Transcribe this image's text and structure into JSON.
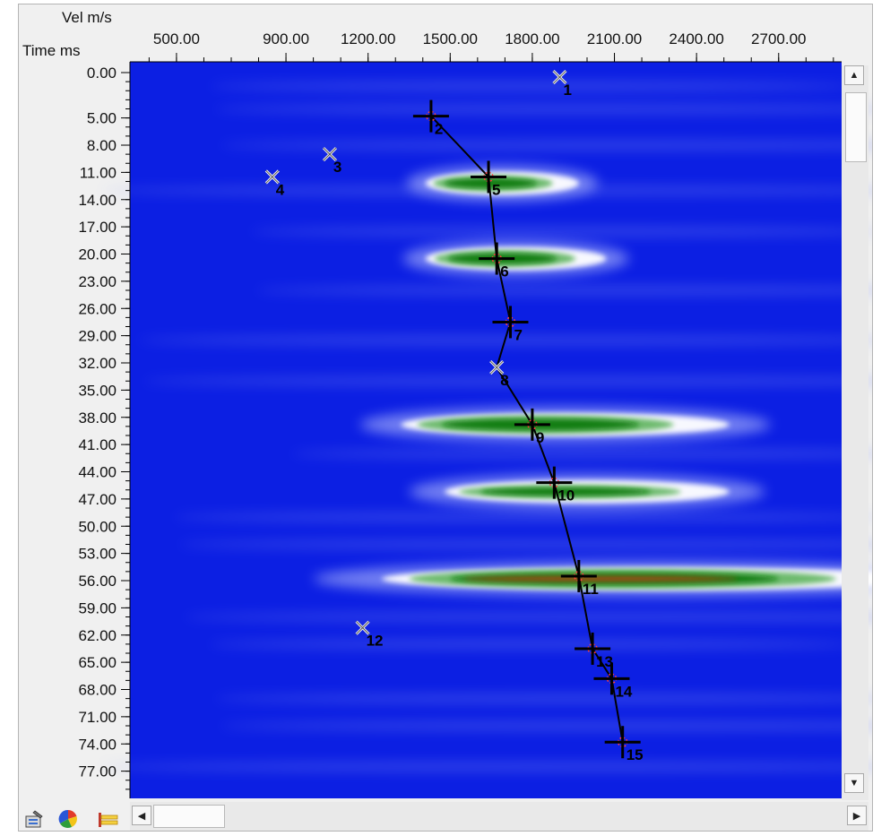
{
  "app": {
    "vel_label": "Vel m/s",
    "time_label": "Time ms"
  },
  "chart_data": {
    "type": "scatter",
    "title": "",
    "xlabel": "Vel m/s",
    "ylabel": "Time ms",
    "x_ticks": [
      "500.00",
      "900.00",
      "1200.00",
      "1500.00",
      "1800.00",
      "2100.00",
      "2400.00",
      "2700.00"
    ],
    "x_tick_values": [
      500,
      900,
      1200,
      1500,
      1800,
      2100,
      2400,
      2700
    ],
    "y_ticks": [
      "0.00",
      "5.00",
      "8.00",
      "11.00",
      "14.00",
      "17.00",
      "20.00",
      "23.00",
      "26.00",
      "29.00",
      "32.00",
      "35.00",
      "38.00",
      "41.00",
      "44.00",
      "47.00",
      "50.00",
      "53.00",
      "56.00",
      "59.00",
      "62.00",
      "65.00",
      "68.00",
      "71.00",
      "74.00",
      "77.00"
    ],
    "y_tick_values": [
      0,
      5,
      8,
      11,
      14,
      17,
      20,
      23,
      26,
      29,
      32,
      35,
      38,
      41,
      44,
      47,
      50,
      53,
      56,
      59,
      62,
      65,
      68,
      71,
      74,
      77
    ],
    "xlim": [
      330,
      2930
    ],
    "ylim": [
      0,
      80
    ],
    "picks": [
      {
        "label": "1",
        "velocity": 1900,
        "time": 0.5,
        "style": "x"
      },
      {
        "label": "2",
        "velocity": 1430,
        "time": 4.8,
        "style": "cross"
      },
      {
        "label": "3",
        "velocity": 1060,
        "time": 9.0,
        "style": "x"
      },
      {
        "label": "4",
        "velocity": 850,
        "time": 11.5,
        "style": "x"
      },
      {
        "label": "5",
        "velocity": 1640,
        "time": 11.5,
        "style": "cross"
      },
      {
        "label": "6",
        "velocity": 1670,
        "time": 20.5,
        "style": "cross"
      },
      {
        "label": "7",
        "velocity": 1720,
        "time": 27.5,
        "style": "cross"
      },
      {
        "label": "8",
        "velocity": 1670,
        "time": 32.5,
        "style": "x"
      },
      {
        "label": "9",
        "velocity": 1800,
        "time": 38.8,
        "style": "cross"
      },
      {
        "label": "10",
        "velocity": 1880,
        "time": 45.2,
        "style": "cross"
      },
      {
        "label": "11",
        "velocity": 1970,
        "time": 55.5,
        "style": "cross"
      },
      {
        "label": "12",
        "velocity": 1180,
        "time": 61.2,
        "style": "x"
      },
      {
        "label": "13",
        "velocity": 2020,
        "time": 63.5,
        "style": "cross"
      },
      {
        "label": "14",
        "velocity": 2090,
        "time": 66.8,
        "style": "cross"
      },
      {
        "label": "15",
        "velocity": 2130,
        "time": 73.8,
        "style": "cross"
      }
    ],
    "velocity_curve": [
      "2",
      "5",
      "6",
      "7",
      "8",
      "9",
      "10",
      "11",
      "13",
      "14",
      "15"
    ],
    "semblance_peaks": [
      {
        "time": 12.2,
        "v_center": 1690,
        "v_halfwidth": 280,
        "intensity": 0.75
      },
      {
        "time": 20.5,
        "v_center": 1740,
        "v_halfwidth": 330,
        "intensity": 0.8
      },
      {
        "time": 38.8,
        "v_center": 1920,
        "v_halfwidth": 600,
        "intensity": 0.9
      },
      {
        "time": 46.2,
        "v_center": 2000,
        "v_halfwidth": 520,
        "intensity": 0.6
      },
      {
        "time": 55.8,
        "v_center": 2250,
        "v_halfwidth": 1000,
        "intensity": 1.0
      }
    ],
    "colors": {
      "background": "#0c1fe3",
      "peak_core": "#117a11",
      "peak_mid": "#66b766",
      "peak_halo": "#ffffff",
      "peak_hot": "#d9381e",
      "curve": "#000000"
    }
  },
  "toolbar": {
    "icons": [
      "properties-icon",
      "color-palette-icon",
      "color-bar-icon"
    ]
  }
}
